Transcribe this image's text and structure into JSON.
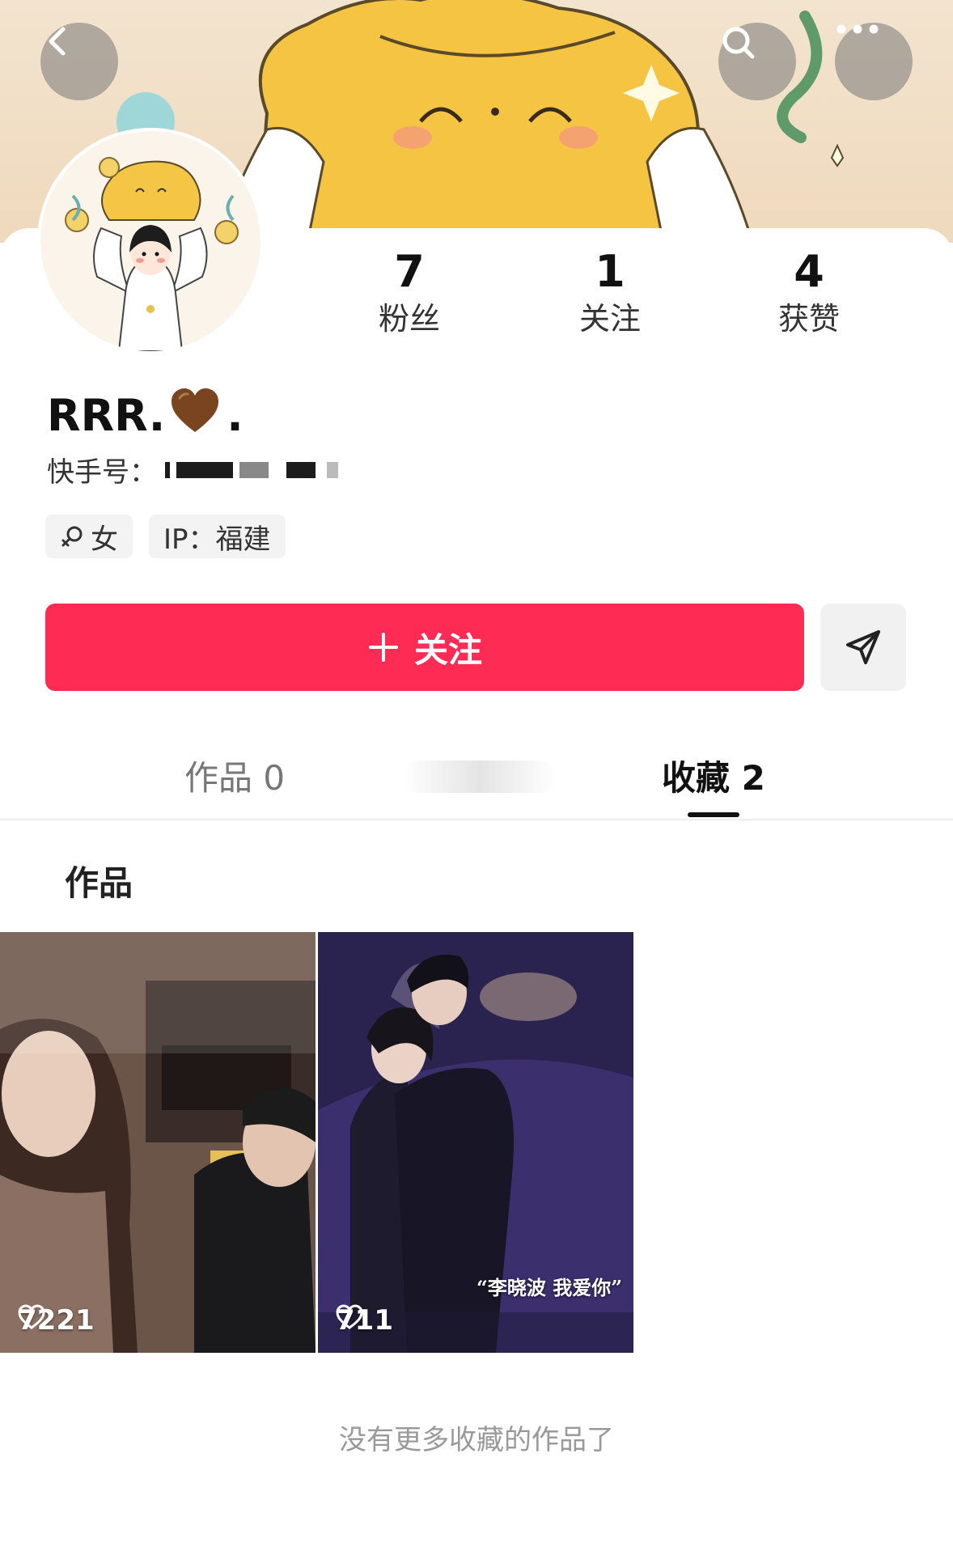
{
  "header": {
    "back_icon": "chevron-left-icon",
    "search_icon": "search-icon",
    "more_icon": "more-horizontal-icon"
  },
  "profile": {
    "name": "RRR.",
    "name_suffix": ".",
    "heart_color": "#7a4420",
    "id_label": "快手号：",
    "gender_tag": "女",
    "ip_tag": "IP：福建"
  },
  "stats": [
    {
      "count": "7",
      "label": "粉丝"
    },
    {
      "count": "1",
      "label": "关注"
    },
    {
      "count": "4",
      "label": "获赞"
    }
  ],
  "actions": {
    "follow_label": "关注",
    "follow_color": "#fe2c55"
  },
  "tabs": [
    {
      "label": "作品 0",
      "active": false
    },
    {
      "label": "收藏 2",
      "active": true
    }
  ],
  "section": {
    "title": "作品"
  },
  "videos": [
    {
      "likes": "7221"
    },
    {
      "likes": "711",
      "caption": "“李晓波 我爱你”"
    }
  ],
  "footer": {
    "end_text": "没有更多收藏的作品了"
  }
}
